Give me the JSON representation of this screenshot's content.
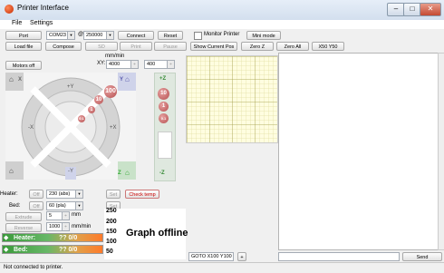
{
  "window": {
    "title": "Printer Interface",
    "controls": {
      "minimize": "–",
      "maximize": "□",
      "close": "✕"
    }
  },
  "menu": {
    "file": "File",
    "settings": "Settings"
  },
  "toolbar1": {
    "port_label": "Port",
    "port_value": "COM23",
    "at_label": "@",
    "baud_value": "250000",
    "connect": "Connect",
    "reset": "Reset",
    "monitor_printer": "Monitor Printer",
    "mini_mode": "Mini mode"
  },
  "toolbar2": {
    "load_file": "Load file",
    "compose": "Compose",
    "sd": "SD",
    "print": "Print",
    "pause": "Pause",
    "show_current_pos": "Show Current Pos",
    "zero_z": "Zero Z",
    "zero_all": "Zero All",
    "x50y50": "X50 Y50"
  },
  "motors_off": "Motors off",
  "feedrate": {
    "units": "mm/min",
    "xy_label": "XY:",
    "xy_value": "4000",
    "z_value": "400"
  },
  "jog": {
    "y_plus": "+Y",
    "y_minus": "-Y",
    "x_plus": "+X",
    "x_minus": "-X",
    "home_x": "X",
    "home_y": "Y",
    "home_z": "Z",
    "step_100": "100",
    "step_10": "10",
    "step_1": "1",
    "step_01": "0.1",
    "z_plus": "+Z",
    "z_minus": "-Z",
    "z_10": "10",
    "z_1": "1",
    "z_01": "0.1"
  },
  "heater": {
    "label": "Heater:",
    "off": "Off",
    "value": "230 (abs)",
    "set": "Set",
    "check_temp": "Check temp"
  },
  "bed": {
    "label": "Bed:",
    "off": "Off",
    "value": "60 (pla)",
    "set": "Set"
  },
  "extrude": {
    "extrude_btn": "Extrude",
    "amount": "5",
    "amount_unit": "mm",
    "reverse_btn": "Reverse",
    "speed": "1000",
    "speed_unit": "mm/min"
  },
  "temps": {
    "heater_label": "Heater:",
    "heater_value": "?? 0/0",
    "bed_label": "Bed:",
    "bed_value": "?? 0/0"
  },
  "graph": {
    "ticks": [
      "250",
      "200",
      "150",
      "100",
      "50"
    ],
    "message": "Graph offline"
  },
  "bottom": {
    "goto_value": "GOTO X100 Y100",
    "plus": "+",
    "send": "Send"
  },
  "status": "Not connected to printer.",
  "colors": {
    "heater_bar": "#3a9a3a",
    "bed_bar": "#ff7a2a",
    "graph_bg": "#fffde0",
    "graph_grid": "#d6d38a"
  }
}
